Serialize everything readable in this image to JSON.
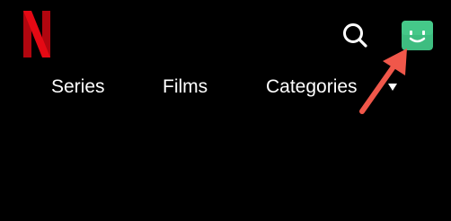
{
  "header": {
    "logo": {
      "icon": "netflix-n-logo",
      "color": "#e50914"
    },
    "search_icon": "search-icon",
    "avatar": {
      "icon": "smiley-face-icon",
      "color": "#3ebd80"
    }
  },
  "nav": {
    "items": [
      {
        "label": "Series"
      },
      {
        "label": "Films"
      },
      {
        "label": "Categories"
      }
    ],
    "categories_dropdown_icon": "caret-down-icon"
  },
  "annotation": {
    "icon": "arrow-icon",
    "color": "#f0574a"
  }
}
